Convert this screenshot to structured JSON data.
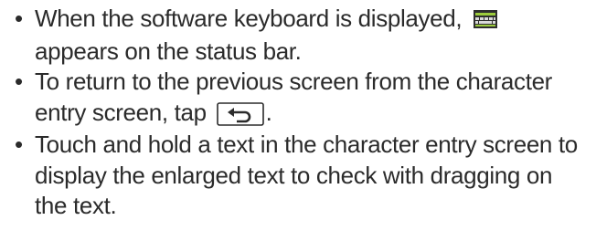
{
  "bullets": [
    {
      "text_before_icon": "When the software keyboard is displayed, ",
      "icon": "keyboard-status-icon",
      "text_after_icon": "appears on the status bar."
    },
    {
      "text_before_icon": "To return to the previous screen from the character entry screen, tap ",
      "icon": "back-key-icon",
      "text_after_icon": "."
    },
    {
      "text": "Touch and hold a text in the character entry screen to display the enlarged text to check with dragging on the text."
    }
  ],
  "bullet_symbol": "•",
  "colors": {
    "text": "#2b2b2b",
    "keyboard_icon_body": "#2e2e2e",
    "keyboard_icon_accent": "#9ccc3c"
  }
}
